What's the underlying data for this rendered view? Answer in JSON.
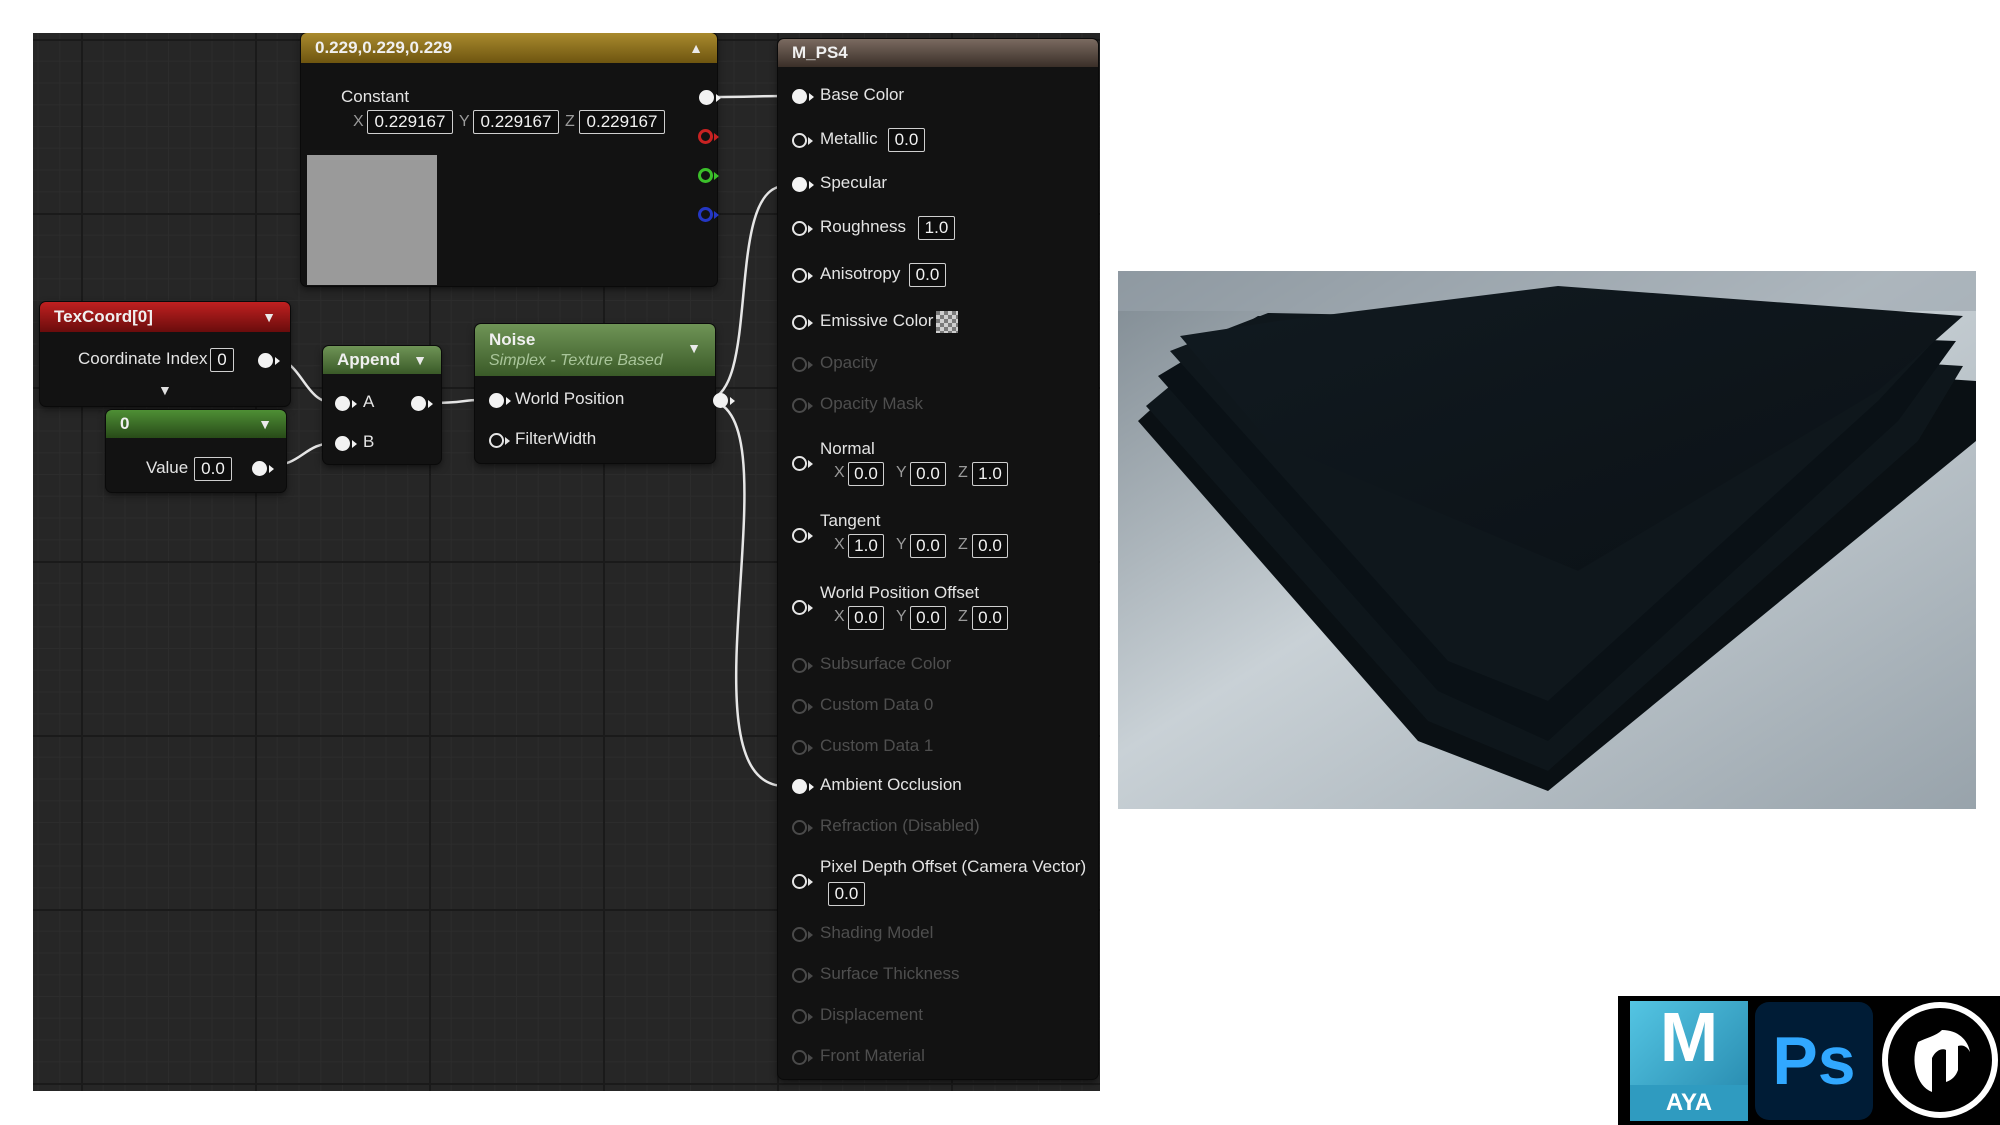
{
  "constant_node": {
    "title": "0.229,0.229,0.229",
    "output_label": "Constant",
    "axis_x": "X",
    "axis_y": "Y",
    "axis_z": "Z",
    "x": "0.229167",
    "y": "0.229167",
    "z": "0.229167",
    "preview_color": "#9a9a9a",
    "header_color": "#8a6d1c"
  },
  "texcoord_node": {
    "title": "TexCoord[0]",
    "label": "Coordinate Index",
    "value": "0",
    "header_color": "#a01818"
  },
  "scalar_node": {
    "title": "0",
    "label": "Value",
    "value": "0.0",
    "header_color": "#3f7a2a"
  },
  "append_node": {
    "title": "Append",
    "input_a": "A",
    "input_b": "B",
    "header_color": "#587a43"
  },
  "noise_node": {
    "title": "Noise",
    "subtitle": "Simplex - Texture Based",
    "input_1": "World Position",
    "input_2": "FilterWidth",
    "header_color": "#587a43"
  },
  "material_node": {
    "title": "M_PS4",
    "header_color": "#5a4a40",
    "base_color": "Base Color",
    "metallic": "Metallic",
    "metallic_value": "0.0",
    "specular": "Specular",
    "roughness": "Roughness",
    "roughness_value": "1.0",
    "anisotropy": "Anisotropy",
    "anisotropy_value": "0.0",
    "emissive": "Emissive Color",
    "opacity": "Opacity",
    "opacity_mask": "Opacity Mask",
    "normal": "Normal",
    "normal_x": "0.0",
    "normal_y": "0.0",
    "normal_z": "1.0",
    "tangent": "Tangent",
    "tangent_x": "1.0",
    "tangent_y": "0.0",
    "tangent_z": "0.0",
    "wpo": "World Position Offset",
    "wpo_x": "0.0",
    "wpo_y": "0.0",
    "wpo_z": "0.0",
    "subsurface": "Subsurface Color",
    "custom0": "Custom Data 0",
    "custom1": "Custom Data 1",
    "ao": "Ambient Occlusion",
    "refraction": "Refraction (Disabled)",
    "pdo": "Pixel Depth Offset (Camera Vector)",
    "pdo_value": "0.0",
    "shading_model": "Shading Model",
    "surface_thickness": "Surface Thickness",
    "displacement": "Displacement",
    "front_material": "Front Material",
    "axis_x": "X",
    "axis_y": "Y",
    "axis_z": "Z"
  },
  "logos": {
    "maya_letter": "M",
    "maya_text": "AYA",
    "photoshop_text": "Ps",
    "maya_color": "#2f9bc0",
    "photoshop_color": "#31a8ff",
    "unreal_icon": "unreal-engine-logo"
  }
}
